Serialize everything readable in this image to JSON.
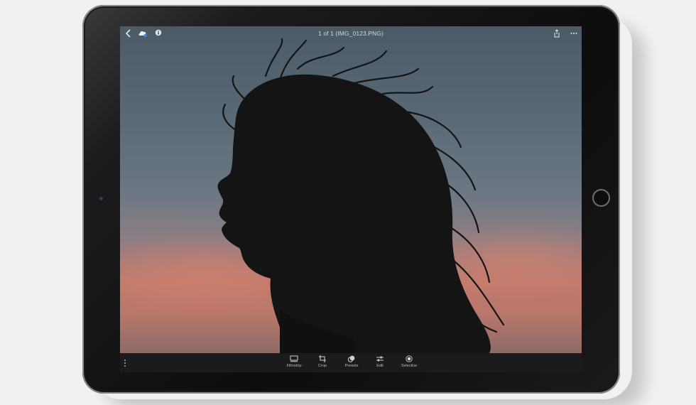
{
  "toolbar_top": {
    "title": "1 of 1 (IMG_0123.PNG)",
    "left_icons": [
      "back-icon",
      "cloud-sync-icon",
      "info-icon"
    ],
    "right_icons": [
      "share-icon",
      "more-icon"
    ]
  },
  "toolbar_bottom": {
    "tools": [
      {
        "label": "Filmstrip",
        "icon": "filmstrip-icon"
      },
      {
        "label": "Crop",
        "icon": "crop-icon"
      },
      {
        "label": "Presets",
        "icon": "presets-icon"
      },
      {
        "label": "Edit",
        "icon": "edit-sliders-icon"
      },
      {
        "label": "Selective",
        "icon": "selective-icon"
      }
    ],
    "menu_icon": "more-vertical-icon"
  },
  "colors": {
    "sky_top": "#4b5a66",
    "sky_horizon": "#c07a6c",
    "toolbar_bg": "#1b1b1b",
    "cloud_accent": "#3d8bf2"
  }
}
